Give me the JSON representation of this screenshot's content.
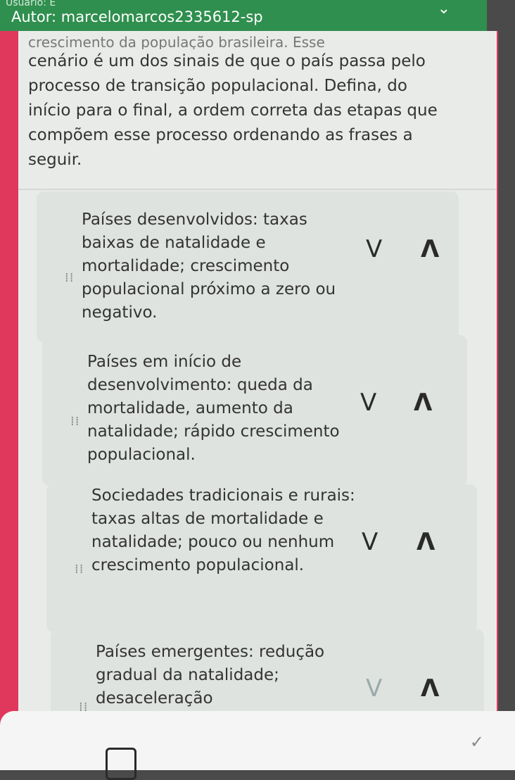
{
  "header": {
    "user": "Usuário: E",
    "author": "Autor: marcelomarcos2335612-sp",
    "chevron_icon": "chevron-down-icon"
  },
  "question": {
    "faded_line": "crescimento da população brasileira. Esse",
    "text": "cenário é um dos sinais de que o país passa pelo processo de transição populacional. Defina, do início para o final, a ordem correta das etapas que compõem esse processo ordenando as frases a seguir."
  },
  "items": [
    {
      "text": "Países desenvolvidos: taxas baixas de natalidade e mortalidade; crescimento populacional próximo a zero ou negativo.",
      "down": "V",
      "up": "Λ"
    },
    {
      "text": "Países em início de desenvolvimento: queda da mortalidade, aumento da natalidade; rápido crescimento populacional.",
      "down": "V",
      "up": "Λ"
    },
    {
      "text": "Sociedades tradicionais e rurais: taxas altas de mortalidade e natalidade; pouco ou nenhum crescimento populacional.",
      "down": "V",
      "up": "Λ"
    },
    {
      "text": "Países emergentes: redução gradual da natalidade; desaceleração",
      "down": "V",
      "up": "Λ"
    }
  ],
  "footer": {
    "check_icon": "check-icon",
    "doc_icon": "document-icon"
  }
}
